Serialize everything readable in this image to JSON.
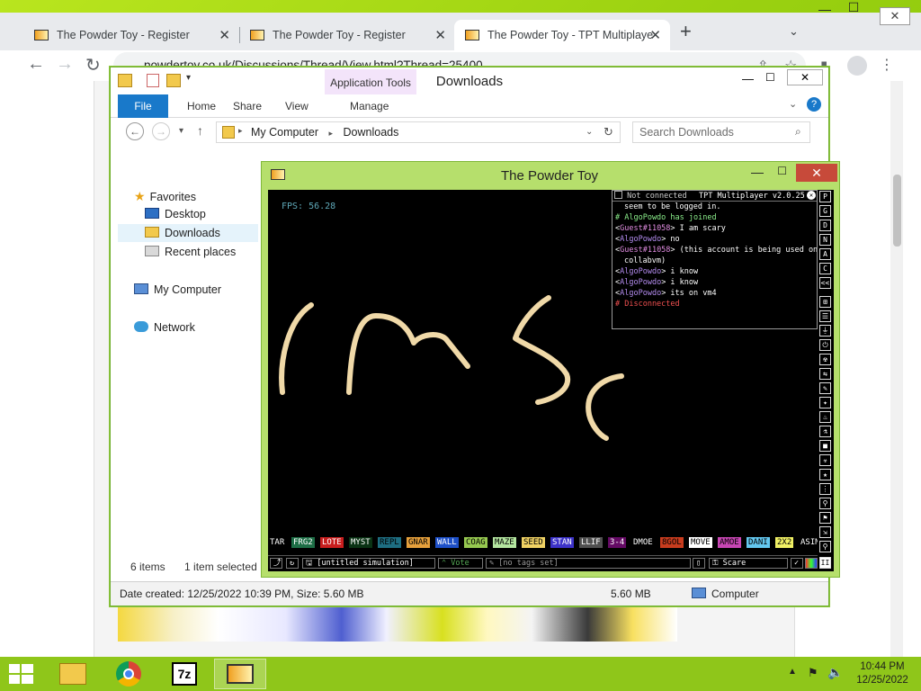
{
  "browser": {
    "tabs": [
      {
        "label": "The Powder Toy - Register",
        "active": false
      },
      {
        "label": "The Powder Toy - Register",
        "active": false
      },
      {
        "label": "The Powder Toy - TPT Multiplaye",
        "active": true
      }
    ],
    "url": "powdertoy.co.uk/Discussions/Thread/View.html?Thread=25400",
    "new_tab_label": "+",
    "close_glyph": "✕",
    "tab_search_glyph": "⌄"
  },
  "explorer": {
    "title": "Downloads",
    "ribbon_context_label": "Application Tools",
    "ribbon_tabs": {
      "file": "File",
      "home": "Home",
      "share": "Share",
      "view": "View",
      "manage": "Manage"
    },
    "breadcrumb": [
      "My Computer",
      "Downloads"
    ],
    "search_placeholder": "Search Downloads",
    "nav": {
      "favorites": "Favorites",
      "desktop": "Desktop",
      "downloads": "Downloads",
      "recent": "Recent places",
      "my_computer": "My Computer",
      "network": "Network"
    },
    "status": {
      "items": "6 items",
      "selected": "1 item selected"
    },
    "details": {
      "created": "Date created: 12/25/2022 10:39 PM, Size: 5.60 MB",
      "size": "5.60 MB",
      "location": "Computer"
    }
  },
  "powder_toy": {
    "window_title": "The Powder Toy",
    "fps": "FPS: 56.28",
    "chat_header": {
      "status": "Not connected",
      "version": "TPT Multiplayer v2.0.25"
    },
    "chat_lines": [
      {
        "segments": [
          {
            "text": "seem to be logged in.",
            "color": "#ffffff"
          }
        ],
        "indent": true
      },
      {
        "segments": [
          {
            "text": "# AlgoPowdo has joined",
            "color": "#8cf08c"
          }
        ]
      },
      {
        "segments": [
          {
            "text": "<",
            "color": "#ffffff"
          },
          {
            "text": "Guest#11058",
            "color": "#e08ce0"
          },
          {
            "text": "> I am scary",
            "color": "#ffffff"
          }
        ]
      },
      {
        "segments": [
          {
            "text": "<",
            "color": "#ffffff"
          },
          {
            "text": "AlgoPowdo",
            "color": "#b48cf0"
          },
          {
            "text": "> no",
            "color": "#ffffff"
          }
        ]
      },
      {
        "segments": [
          {
            "text": "<",
            "color": "#ffffff"
          },
          {
            "text": "Guest#11058",
            "color": "#e08ce0"
          },
          {
            "text": "> (this account is being used on",
            "color": "#ffffff"
          }
        ]
      },
      {
        "segments": [
          {
            "text": "collabvm)",
            "color": "#ffffff"
          }
        ],
        "indent": true
      },
      {
        "segments": [
          {
            "text": "<",
            "color": "#ffffff"
          },
          {
            "text": "AlgoPowdo",
            "color": "#b48cf0"
          },
          {
            "text": "> i know",
            "color": "#ffffff"
          }
        ]
      },
      {
        "segments": [
          {
            "text": "<",
            "color": "#ffffff"
          },
          {
            "text": "AlgoPowdo",
            "color": "#b48cf0"
          },
          {
            "text": "> i know",
            "color": "#ffffff"
          }
        ]
      },
      {
        "segments": [
          {
            "text": "<",
            "color": "#ffffff"
          },
          {
            "text": "AlgoPowdo",
            "color": "#b48cf0"
          },
          {
            "text": "> its on vm4",
            "color": "#ffffff"
          }
        ]
      },
      {
        "segments": [
          {
            "text": "# Disconnected",
            "color": "#f05050"
          }
        ]
      }
    ],
    "elements": [
      {
        "name": "TAR",
        "bg": "#000000",
        "fg": "#ffffff"
      },
      {
        "name": "FRG2",
        "bg": "#1e6e46",
        "fg": "#ffffff"
      },
      {
        "name": "LOTE",
        "bg": "#c81e1e",
        "fg": "#ffffff"
      },
      {
        "name": "MYST",
        "bg": "#0a3214",
        "fg": "#ffffff"
      },
      {
        "name": "REPL",
        "bg": "#1e6e82",
        "fg": "#000000"
      },
      {
        "name": "GNAR",
        "bg": "#e6a03c",
        "fg": "#000000"
      },
      {
        "name": "WALL",
        "bg": "#1e50c8",
        "fg": "#ffffff"
      },
      {
        "name": "COAG",
        "bg": "#96c850",
        "fg": "#000000"
      },
      {
        "name": "MAZE",
        "bg": "#b4e6a0",
        "fg": "#000000"
      },
      {
        "name": "SEED",
        "bg": "#f0d264",
        "fg": "#000000"
      },
      {
        "name": "STAN",
        "bg": "#3c32c8",
        "fg": "#ffffff"
      },
      {
        "name": "LLIF",
        "bg": "#505050",
        "fg": "#ffffff"
      },
      {
        "name": "3-4",
        "bg": "#640a64",
        "fg": "#ffffff"
      },
      {
        "name": "DMOE",
        "bg": "#000000",
        "fg": "#ffffff"
      },
      {
        "name": "8GOL",
        "bg": "#c83c1e",
        "fg": "#000000"
      },
      {
        "name": "MOVE",
        "bg": "#ffffff",
        "fg": "#000000"
      },
      {
        "name": "AMOE",
        "bg": "#c846b4",
        "fg": "#000000"
      },
      {
        "name": "DANI",
        "bg": "#64c8f0",
        "fg": "#000000"
      },
      {
        "name": "2X2",
        "bg": "#f0f064",
        "fg": "#000000"
      },
      {
        "name": "ASIM",
        "bg": "#000000",
        "fg": "#ffffff"
      }
    ],
    "bottom": {
      "save_name": "[untitled simulation]",
      "vote": "Vote",
      "tags": "[no tags set]",
      "user": "Scare"
    },
    "side_letters": [
      "P",
      "G",
      "D",
      "N",
      "A",
      "C",
      "<<"
    ],
    "pause_glyph": "II"
  },
  "taskbar": {
    "time": "10:44 PM",
    "date": "12/25/2022"
  }
}
